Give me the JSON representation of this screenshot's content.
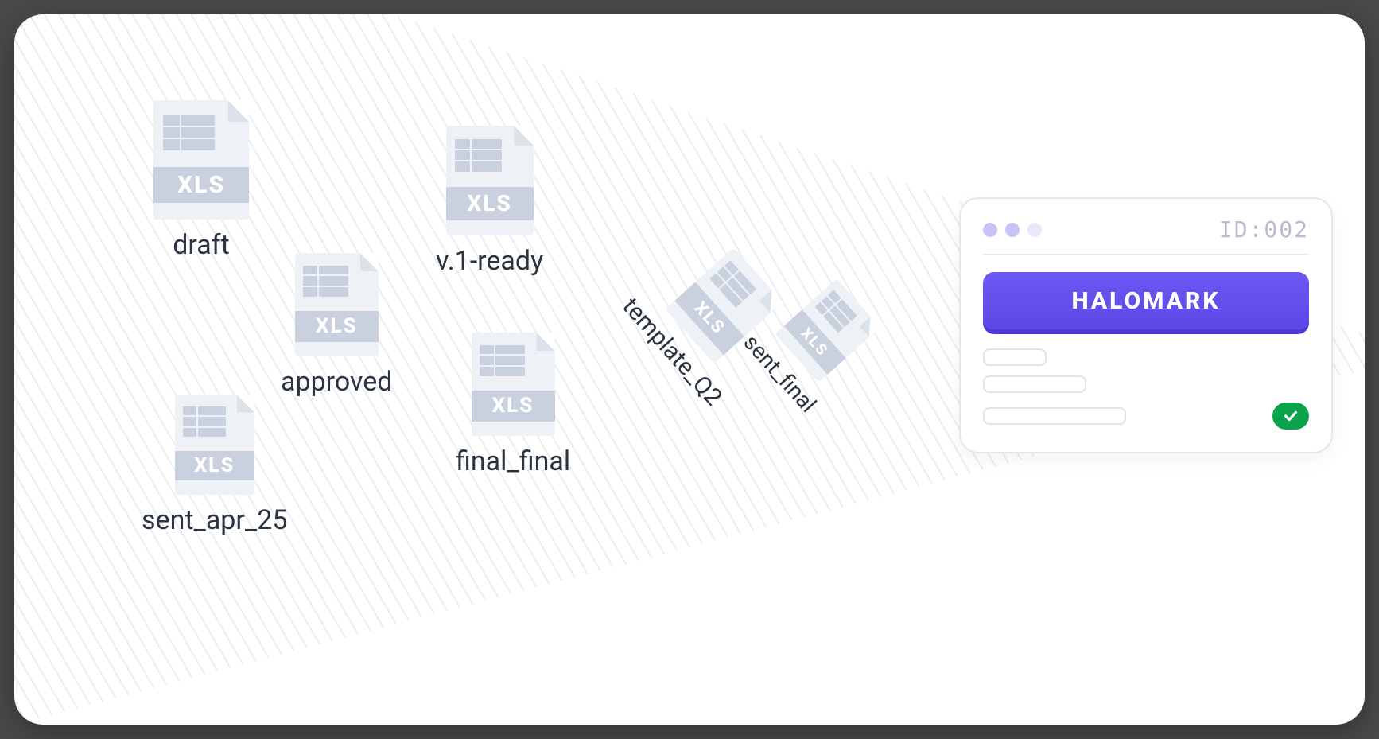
{
  "files": {
    "draft": {
      "label": "draft",
      "type": "XLS"
    },
    "v1ready": {
      "label": "v.1-ready",
      "type": "XLS"
    },
    "approved": {
      "label": "approved",
      "type": "XLS"
    },
    "final_final": {
      "label": "final_final",
      "type": "XLS"
    },
    "sent_apr_25": {
      "label": "sent_apr_25",
      "type": "XLS"
    },
    "template_q2": {
      "label": "template_Q2",
      "type": "XLS"
    },
    "sent_final": {
      "label": "sent_final",
      "type": "XLS"
    }
  },
  "panel": {
    "id_label": "ID:002",
    "button_label": "HALOMARK"
  }
}
